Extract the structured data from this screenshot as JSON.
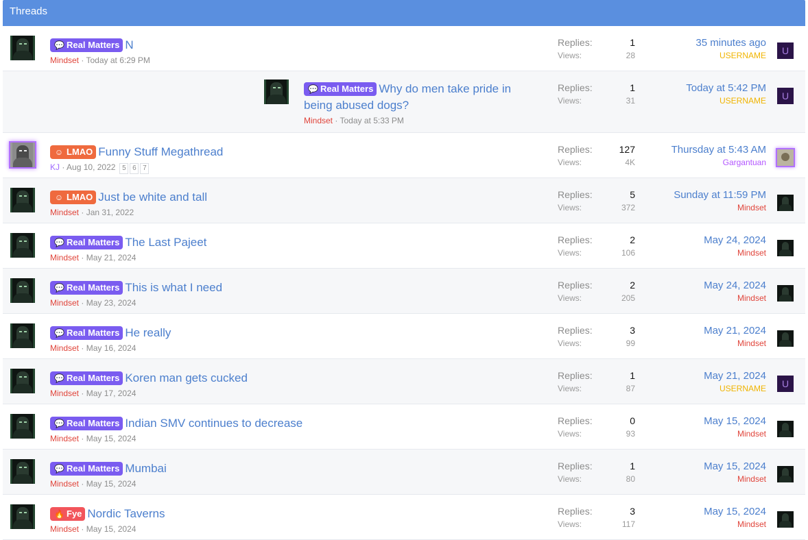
{
  "header": {
    "title": "Threads"
  },
  "stat_labels": {
    "replies": "Replies:",
    "views": "Views:"
  },
  "colors": {
    "header_bg": "#5a8fdf",
    "label_real_matters": "#7a5cf0",
    "label_lmao": "#ef6a3e",
    "label_fye": "#f2555b",
    "link": "#4c7fcd",
    "username_mindset": "#e0443a",
    "username_gold": "#f0b400",
    "username_gargantuan": "#b356ff"
  },
  "threads": [
    {
      "label": "Real Matters",
      "label_icon": "chat-bubble-icon",
      "title": "N",
      "author": "Mindset",
      "date": "Today at 6:29 PM",
      "replies": "1",
      "views": "28",
      "last_date": "35 minutes ago",
      "last_user": "USERNAME"
    },
    {
      "label": "Real Matters",
      "label_icon": "chat-bubble-icon",
      "title": "Why do men take pride in being abused dogs?",
      "author": "Mindset",
      "date": "Today at 5:33 PM",
      "replies": "1",
      "views": "31",
      "last_date": "Today at 5:42 PM",
      "last_user": "USERNAME"
    },
    {
      "label": "LMAO",
      "label_icon": "laugh-icon",
      "title": "Funny Stuff Megathread",
      "author": "KJ",
      "date": "Aug 10, 2022",
      "pages": [
        "5",
        "6",
        "7"
      ],
      "replies": "127",
      "views": "4K",
      "last_date": "Thursday at 5:43 AM",
      "last_user": "Gargantuan"
    },
    {
      "label": "LMAO",
      "label_icon": "laugh-icon",
      "title": "Just be white and tall",
      "author": "Mindset",
      "date": "Jan 31, 2022",
      "replies": "5",
      "views": "372",
      "last_date": "Sunday at 11:59 PM",
      "last_user": "Mindset"
    },
    {
      "label": "Real Matters",
      "label_icon": "chat-bubble-icon",
      "title": "The Last Pajeet",
      "author": "Mindset",
      "date": "May 21, 2024",
      "replies": "2",
      "views": "106",
      "last_date": "May 24, 2024",
      "last_user": "Mindset"
    },
    {
      "label": "Real Matters",
      "label_icon": "chat-bubble-icon",
      "title": "This is what I need",
      "author": "Mindset",
      "date": "May 23, 2024",
      "replies": "2",
      "views": "205",
      "last_date": "May 24, 2024",
      "last_user": "Mindset"
    },
    {
      "label": "Real Matters",
      "label_icon": "chat-bubble-icon",
      "title": "He really",
      "author": "Mindset",
      "date": "May 16, 2024",
      "replies": "3",
      "views": "99",
      "last_date": "May 21, 2024",
      "last_user": "Mindset"
    },
    {
      "label": "Real Matters",
      "label_icon": "chat-bubble-icon",
      "title": "Koren man gets cucked",
      "author": "Mindset",
      "date": "May 17, 2024",
      "replies": "1",
      "views": "87",
      "last_date": "May 21, 2024",
      "last_user": "USERNAME"
    },
    {
      "label": "Real Matters",
      "label_icon": "chat-bubble-icon",
      "title": "Indian SMV continues to decrease",
      "author": "Mindset",
      "date": "May 15, 2024",
      "replies": "0",
      "views": "93",
      "last_date": "May 15, 2024",
      "last_user": "Mindset"
    },
    {
      "label": "Real Matters",
      "label_icon": "chat-bubble-icon",
      "title": "Mumbai",
      "author": "Mindset",
      "date": "May 15, 2024",
      "replies": "1",
      "views": "80",
      "last_date": "May 15, 2024",
      "last_user": "Mindset"
    },
    {
      "label": "Fye",
      "label_icon": "fire-icon",
      "title": "Nordic Taverns",
      "author": "Mindset",
      "date": "May 15, 2024",
      "replies": "3",
      "views": "117",
      "last_date": "May 15, 2024",
      "last_user": "Mindset"
    }
  ],
  "avatar_letter": "U"
}
